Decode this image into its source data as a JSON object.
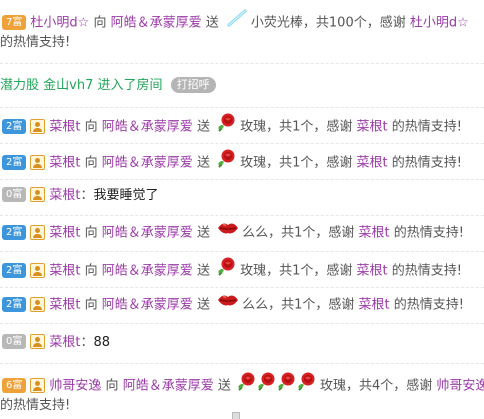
{
  "chat": {
    "messages": [
      {
        "badge": "7富",
        "sender": "杜小明d☆",
        "to_word": "向",
        "receiver": "阿皓＆承蒙厚爱",
        "send_word": "送",
        "gift_icon": "glowstick-icon",
        "gift_text": "小荧光棒，共100个，感谢",
        "thank_name": "杜小明d☆",
        "tail": "的热情支持!"
      },
      {
        "join_text": "潜力股 金山vh7 进入了房间",
        "greet_label": "打招呼"
      },
      {
        "badge": "2富",
        "sender": "菜根t",
        "to_word": "向",
        "receiver": "阿皓＆承蒙厚爱",
        "send_word": "送",
        "gift_icon": "rose-icon",
        "gift_text": "玫瑰，共1个，感谢",
        "thank_name": "菜根t",
        "tail": "的热情支持!"
      },
      {
        "badge": "2富",
        "sender": "菜根t",
        "to_word": "向",
        "receiver": "阿皓＆承蒙厚爱",
        "send_word": "送",
        "gift_icon": "rose-icon",
        "gift_text": "玫瑰，共1个，感谢",
        "thank_name": "菜根t",
        "tail": "的热情支持!"
      },
      {
        "badge": "0富",
        "sender": "菜根t",
        "colon": "：",
        "text": "我要睡觉了"
      },
      {
        "badge": "2富",
        "sender": "菜根t",
        "to_word": "向",
        "receiver": "阿皓＆承蒙厚爱",
        "send_word": "送",
        "gift_icon": "kiss-lips-icon",
        "gift_text": "么么，共1个，感谢",
        "thank_name": "菜根t",
        "tail": "的热情支持!"
      },
      {
        "badge": "2富",
        "sender": "菜根t",
        "to_word": "向",
        "receiver": "阿皓＆承蒙厚爱",
        "send_word": "送",
        "gift_icon": "rose-icon",
        "gift_text": "玫瑰，共1个，感谢",
        "thank_name": "菜根t",
        "tail": "的热情支持!"
      },
      {
        "badge": "2富",
        "sender": "菜根t",
        "to_word": "向",
        "receiver": "阿皓＆承蒙厚爱",
        "send_word": "送",
        "gift_icon": "kiss-lips-icon",
        "gift_text": "么么，共1个，感谢",
        "thank_name": "菜根t",
        "tail": "的热情支持!"
      },
      {
        "badge": "0富",
        "sender": "菜根t",
        "colon": "：",
        "text": "88"
      },
      {
        "badge": "6富",
        "sender": "帅哥安逸",
        "to_word": "向",
        "receiver": "阿皓＆承蒙厚爱",
        "send_word": "送",
        "gift_icon": "rose-icon",
        "gift_text": "玫瑰，共4个，感谢",
        "thank_name": "帅哥安逸",
        "tail": "的热情支持!"
      }
    ]
  },
  "colors": {
    "name": "#9b3aa8",
    "join": "#22a65a",
    "badge_orange": "#f0a23a",
    "badge_blue": "#3d95dc",
    "badge_gray": "#b8b8b8"
  }
}
